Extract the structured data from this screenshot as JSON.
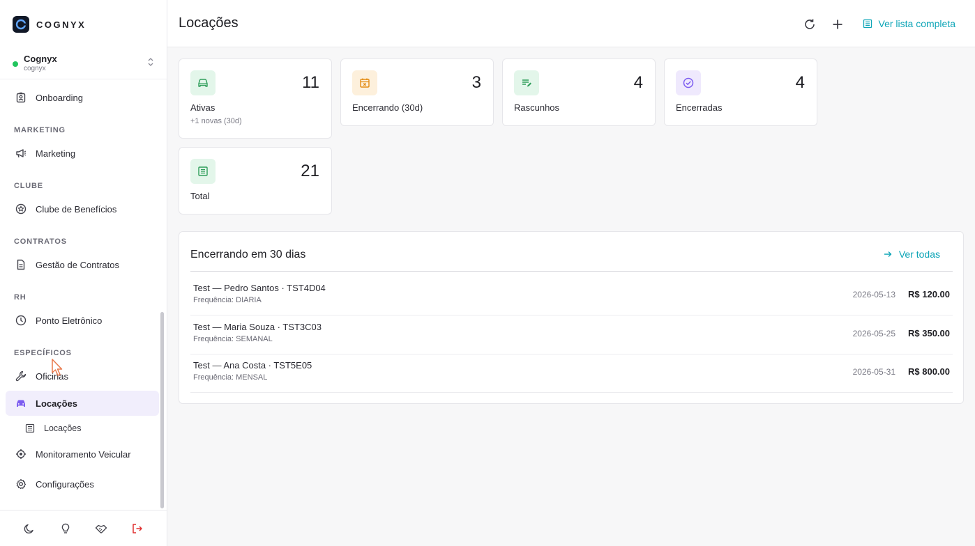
{
  "brand": {
    "name": "COGNYX"
  },
  "org": {
    "name": "Cognyx",
    "slug": "cognyx"
  },
  "nav": {
    "onboarding": "Onboarding",
    "sections": {
      "marketing": "MARKETING",
      "clube": "CLUBE",
      "contratos": "CONTRATOS",
      "rh": "RH",
      "especificos": "ESPECÍFICOS"
    },
    "marketing": "Marketing",
    "clube": "Clube de Benefícios",
    "contratos": "Gestão de Contratos",
    "ponto": "Ponto Eletrônico",
    "oficinas": "Oficinas",
    "locacoes": "Locações",
    "locacoes_sub": "Locações",
    "monitoramento": "Monitoramento Veicular",
    "configuracoes": "Configurações"
  },
  "header": {
    "title": "Locações",
    "list_link": "Ver lista completa"
  },
  "stats": {
    "ativas": {
      "value": "11",
      "label": "Ativas",
      "sub": "+1 novas (30d)"
    },
    "encerrando": {
      "value": "3",
      "label": "Encerrando (30d)"
    },
    "rascunhos": {
      "value": "4",
      "label": "Rascunhos"
    },
    "encerradas": {
      "value": "4",
      "label": "Encerradas"
    },
    "total": {
      "value": "21",
      "label": "Total"
    }
  },
  "panel": {
    "title": "Encerrando em 30 dias",
    "link": "Ver todas",
    "rows": [
      {
        "title": "Test — Pedro Santos · TST4D04",
        "sub": "Frequência: DIARIA",
        "date": "2026-05-13",
        "price": "R$ 120.00"
      },
      {
        "title": "Test — Maria Souza · TST3C03",
        "sub": "Frequência: SEMANAL",
        "date": "2026-05-25",
        "price": "R$ 350.00"
      },
      {
        "title": "Test — Ana Costa · TST5E05",
        "sub": "Frequência: MENSAL",
        "date": "2026-05-31",
        "price": "R$ 800.00"
      }
    ]
  },
  "colors": {
    "accent": "#0ea5b7",
    "active_bg": "#f1eefc",
    "active_icon": "#7c5cf0",
    "status_online": "#22c55e",
    "logout": "#e03131"
  }
}
